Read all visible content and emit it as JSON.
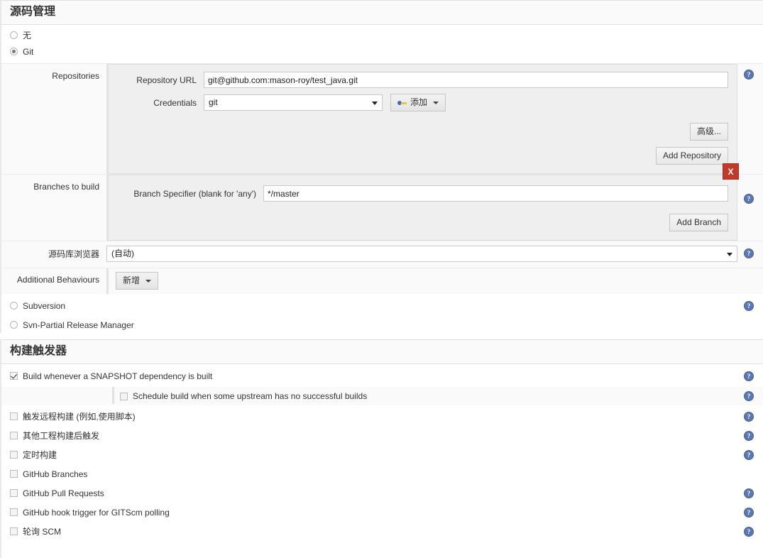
{
  "scm": {
    "title": "源码管理",
    "options": [
      {
        "label": "无",
        "selected": false
      },
      {
        "label": "Git",
        "selected": true
      }
    ],
    "git": {
      "repositories": {
        "label": "Repositories",
        "repository_url_label": "Repository URL",
        "repository_url_value": "git@github.com:mason-roy/test_java.git",
        "credentials_label": "Credentials",
        "credentials_value": "git",
        "add_credentials_button": "添加",
        "advanced_button": "高级...",
        "add_repository_button": "Add Repository"
      },
      "branches": {
        "label": "Branches to build",
        "branch_specifier_label": "Branch Specifier (blank for 'any')",
        "branch_specifier_value": "*/master",
        "delete_button": "X",
        "add_branch_button": "Add Branch"
      },
      "browser": {
        "label": "源码库浏览器",
        "value": "(自动)"
      },
      "additional_behaviours": {
        "label": "Additional Behaviours",
        "add_button": "新增"
      }
    },
    "other_options": [
      {
        "label": "Subversion",
        "selected": false
      },
      {
        "label": "Svn-Partial Release Manager",
        "selected": false
      }
    ]
  },
  "triggers": {
    "title": "构建触发器",
    "items": [
      {
        "label": "Build whenever a SNAPSHOT dependency is built",
        "checked": true,
        "help": true,
        "indent": false,
        "highlight": false
      },
      {
        "label": "Schedule build when some upstream has no successful builds",
        "checked": false,
        "help": true,
        "indent": true,
        "highlight": true
      },
      {
        "label": "触发远程构建 (例如,使用脚本)",
        "checked": false,
        "help": true,
        "indent": false,
        "highlight": false
      },
      {
        "label": "其他工程构建后触发",
        "checked": false,
        "help": true,
        "indent": false,
        "highlight": false
      },
      {
        "label": "定时构建",
        "checked": false,
        "help": true,
        "indent": false,
        "highlight": false
      },
      {
        "label": "GitHub Branches",
        "checked": false,
        "help": false,
        "indent": false,
        "highlight": false
      },
      {
        "label": "GitHub Pull Requests",
        "checked": false,
        "help": true,
        "indent": false,
        "highlight": false
      },
      {
        "label": "GitHub hook trigger for GITScm polling",
        "checked": false,
        "help": true,
        "indent": false,
        "highlight": false
      },
      {
        "label": "轮询 SCM",
        "checked": false,
        "help": true,
        "indent": false,
        "highlight": false
      }
    ]
  },
  "icons": {
    "help": "?",
    "help_icon_name": "help-icon",
    "credentials_key": "key-icon"
  },
  "colors": {
    "delete_red": "#c0392b",
    "help_blue": "#5b79b0",
    "panel_gray": "#efefef",
    "header_gray": "#fafafa"
  }
}
